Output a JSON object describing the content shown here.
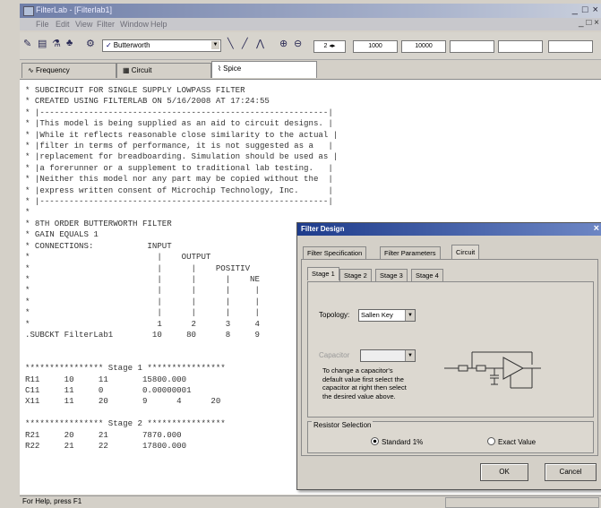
{
  "window": {
    "title": "FilterLab - [Filterlab1]",
    "controls": "_ □ ×",
    "doc_controls": "_ □ ×"
  },
  "menu": [
    "File",
    "Edit",
    "View",
    "Filter",
    "Window",
    "Help"
  ],
  "toolbar": {
    "filter_type": "Butterworth",
    "zoom_value": "2",
    "freq_low": "1000",
    "freq_high": "10000"
  },
  "tabs": [
    {
      "label": "Frequency",
      "icon": "sine-icon"
    },
    {
      "label": "Circuit",
      "icon": "schematic-icon"
    },
    {
      "label": "Spice",
      "icon": "spice-icon"
    }
  ],
  "spice_lines": [
    "* SUBCIRCUIT FOR SINGLE SUPPLY LOWPASS FILTER",
    "* CREATED USING FILTERLAB ON 5/16/2008 AT 17:24:55",
    "* |-----------------------------------------------------------|",
    "* |This model is being supplied as an aid to circuit designs. |",
    "* |While it reflects reasonable close similarity to the actual |",
    "* |filter in terms of performance, it is not suggested as a   |",
    "* |replacement for breadboarding. Simulation should be used as |",
    "* |a forerunner or a supplement to traditional lab testing.   |",
    "* |Neither this model nor any part may be copied without the  |",
    "* |express written consent of Microchip Technology, Inc.      |",
    "* |-----------------------------------------------------------|",
    "*",
    "* 8TH ORDER BUTTERWORTH FILTER",
    "* GAIN EQUALS 1",
    "* CONNECTIONS:           INPUT",
    "*                          |    OUTPUT",
    "*                          |      |    POSITIV",
    "*                          |      |      |    NE",
    "*                          |      |      |     |",
    "*                          |      |      |     |",
    "*                          |      |      |     |",
    "*                          1      2      3     4",
    ".SUBCKT FilterLab1        10     80      8     9",
    "",
    "",
    "**************** Stage 1 ****************",
    "R11     10     11       15800.000",
    "C11     11     0        0.00000001",
    "X11     11     20       9      4      20",
    "",
    "**************** Stage 2 ****************",
    "R21     20     21       7870.000",
    "R22     21     22       17800.000"
  ],
  "status_text": "For Help, press F1",
  "dialog": {
    "title": "Filter Design",
    "tabs": [
      "Filter Specification",
      "Filter Parameters",
      "Circuit"
    ],
    "stage_tabs": [
      "Stage 1",
      "Stage 2",
      "Stage 3",
      "Stage 4"
    ],
    "topology_label": "Topology:",
    "topology_value": "Sallen Key",
    "capacitor_label": "Capacitor",
    "capacitor_help": "To change a capacitor's default value first select the capacitor at right then select the desired value above.",
    "resistor_group": "Resistor Selection",
    "radio_standard": "Standard 1%",
    "radio_exact": "Exact Value",
    "ok": "OK",
    "cancel": "Cancel"
  }
}
